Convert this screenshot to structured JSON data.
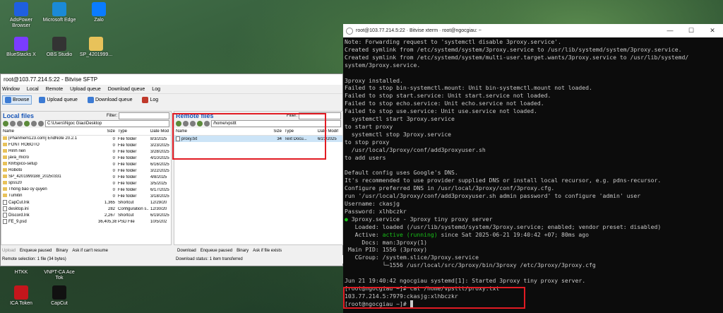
{
  "desktop": {
    "icons": [
      {
        "label": "AdsPower Browser",
        "color": "#1f5fe0"
      },
      {
        "label": "Microsoft Edge",
        "color": "#1b8ad6"
      },
      {
        "label": "Zalo",
        "color": "#0a7cff"
      },
      {
        "label": "BlueStacks X",
        "color": "#7a3cff"
      },
      {
        "label": "OBS Studio",
        "color": "#333333"
      },
      {
        "label": "SP_4201999...",
        "color": "#e8c25a"
      },
      {
        "label": "HTKK",
        "color": "#2a2a2a"
      },
      {
        "label": "VNPT-CA Ace Tok",
        "color": "#2a2a2a"
      },
      {
        "label": "ICA Token",
        "color": "#c4161c"
      },
      {
        "label": "CapCut",
        "color": "#111111"
      }
    ]
  },
  "sftp": {
    "title": "root@103.77.214.5:22 - Bitvise SFTP",
    "menu": [
      "Window",
      "Local",
      "Remote",
      "Upload queue",
      "Download queue",
      "Log"
    ],
    "toolbar": [
      "Browse",
      "Upload queue",
      "Download queue",
      "Log"
    ],
    "local": {
      "heading": "Local files",
      "filter_label": "Filter:",
      "path": "C:\\Users\\Ngoc Giau\\Desktop",
      "columns": [
        "Name",
        "Size",
        "Type",
        "Date Mod"
      ],
      "rows": [
        {
          "name": "[Phanmem123.com] EndNote 20.2.1",
          "size": "0",
          "type": "File folder",
          "date": "8/3/2025"
        },
        {
          "name": "FONT ROBOTO",
          "size": "0",
          "type": "File folder",
          "date": "3/23/2025"
        },
        {
          "name": "Hình nền",
          "size": "0",
          "type": "File folder",
          "date": "3/28/2025"
        },
        {
          "name": "java_micro",
          "size": "0",
          "type": "File folder",
          "date": "4/10/2025"
        },
        {
          "name": "KMSpico-setup",
          "size": "0",
          "type": "File folder",
          "date": "6/16/2025"
        },
        {
          "name": "Roboto",
          "size": "0",
          "type": "File folder",
          "date": "3/22/2025"
        },
        {
          "name": "SP_4201999188_20250331",
          "size": "0",
          "type": "File folder",
          "date": "4/8/2025"
        },
        {
          "name": "spss20",
          "size": "0",
          "type": "File folder",
          "date": "3/5/2025"
        },
        {
          "name": "Thông báo ủy quyền",
          "size": "0",
          "type": "File folder",
          "date": "6/17/2025"
        },
        {
          "name": "Tumitin",
          "size": "0",
          "type": "File folder",
          "date": "3/18/2025"
        },
        {
          "name": "CapCut.lnk",
          "size": "1,365",
          "type": "Shortcut",
          "date": "12/29/20"
        },
        {
          "name": "desktop.ini",
          "size": "282",
          "type": "Configuration s...",
          "date": "12/30/20"
        },
        {
          "name": "Discord.lnk",
          "size": "2,267",
          "type": "Shortcut",
          "date": "6/19/2025"
        },
        {
          "name": "FE_9.psd",
          "size": "36,405,381",
          "type": "PSD File",
          "date": "10/5/202"
        }
      ],
      "queue": [
        "Upload",
        "Enqueue paused",
        "Binary",
        "Ask if can't resume"
      ]
    },
    "remote": {
      "heading": "Remote files",
      "filter_label": "Filter:",
      "path": "/home/vpsttt",
      "columns": [
        "Name",
        "Size",
        "Type",
        "Date Modif"
      ],
      "rows": [
        {
          "name": "proxy.txt",
          "size": "34",
          "type": "Text Docu...",
          "date": "6/21/2025"
        }
      ],
      "queue": [
        "Download",
        "Enqueue paused",
        "Binary",
        "Ask if file exists"
      ]
    },
    "status_left": "Remote selection: 1 file (34 bytes)",
    "status_right": "Download status: 1 item transferred"
  },
  "terminal": {
    "title": "root@103.77.214.5:22 · Bitvise xterm · root@ngocgiau: ~",
    "lines": [
      "Note: Forwarding request to 'systemctl disable 3proxy.service'.",
      "Created symlink from /etc/systemd/system/3proxy.service to /usr/lib/systemd/system/3proxy.service.",
      "Created symlink from /etc/systemd/system/multi-user.target.wants/3proxy.service to /usr/lib/systemd/",
      "system/3proxy.service.",
      "",
      "3proxy installed.",
      "Failed to stop bin-systemctl.mount: Unit bin-systemctl.mount not loaded.",
      "Failed to stop start.service: Unit start.service not loaded.",
      "Failed to stop echo.service: Unit echo.service not loaded.",
      "Failed to stop use.service: Unit use.service not loaded.",
      "  systemctl start 3proxy.service",
      "to start proxy",
      "  systemctl stop 3proxy.service",
      "to stop proxy",
      "  /usr/local/3proxy/conf/add3proxyuser.sh",
      "to add users",
      "",
      "Default config uses Google's DNS.",
      "It's recommended to use provider supplied DNS or install local recursor, e.g. pdns-recursor.",
      "Configure preferred DNS in /usr/local/3proxy/conf/3proxy.cfg.",
      "run '/usr/local/3proxy/conf/add3proxyuser.sh admin password' to configure 'admin' user",
      "Username: ckasjg",
      "Password: xlhbczkr"
    ],
    "service_bullet": "●",
    "service_line": " 3proxy.service - 3proxy tiny proxy server",
    "loaded_line": "   Loaded: loaded (/usr/lib/systemd/system/3proxy.service; enabled; vendor preset: disabled)",
    "active_prefix": "   Active: ",
    "active_status": "active (running)",
    "active_suffix": " since Sat 2025-06-21 19:40:42 +07; 80ms ago",
    "tail_lines": [
      "     Docs: man:3proxy(1)",
      " Main PID: 1556 (3proxy)",
      "   CGroup: /system.slice/3proxy.service",
      "           └─1556 /usr/local/src/3proxy/bin/3proxy /etc/3proxy/3proxy.cfg",
      "",
      "Jun 21 19:40:42 ngocgiau systemd[1]: Started 3proxy tiny proxy server."
    ],
    "cmd_line": "[root@ngocgiau ~]# cat /home/vpsttt/proxy.txt",
    "output_line": "103.77.214.5:7979:ckasjg:xlhbczkr",
    "prompt_line": "[root@ngocgiau ~]# "
  },
  "colors": {
    "highlight": "#e21b23",
    "terminal_green": "#18c018"
  }
}
